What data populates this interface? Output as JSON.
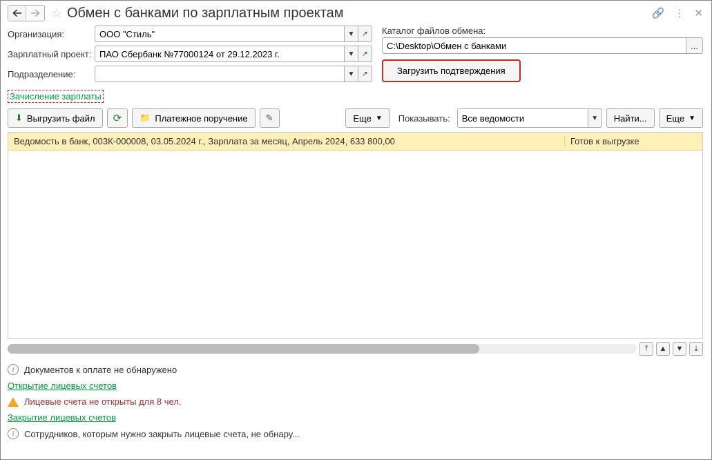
{
  "header": {
    "title": "Обмен с банками по зарплатным проектам"
  },
  "form": {
    "org_label": "Организация:",
    "org_value": "ООО \"Стиль\"",
    "project_label": "Зарплатный проект:",
    "project_value": "ПАО Сбербанк №77000124 от 29.12.2023 г.",
    "dept_label": "Подразделение:",
    "dept_value": ""
  },
  "catalog": {
    "label": "Каталог файлов обмена:",
    "value": "C:\\Desktop\\Обмен с банками",
    "browse": "...",
    "load_btn": "Загрузить подтверждения"
  },
  "tab": {
    "label": "Зачисление зарплаты"
  },
  "toolbar": {
    "export_label": "Выгрузить файл",
    "payorder_label": "Платежное поручение",
    "more1": "Еще",
    "show_label": "Показывать:",
    "filter_value": "Все ведомости",
    "find_label": "Найти...",
    "more2": "Еще"
  },
  "grid": {
    "rows": [
      {
        "main": "Ведомость в банк, 003К-000008, 03.05.2024 г., Зарплата за месяц, Апрель 2024, 633 800,00",
        "status": "Готов к выгрузке"
      }
    ]
  },
  "footer": {
    "no_docs": "Документов к оплате не обнаружено",
    "open_accounts": "Открытие лицевых счетов",
    "warn": "Лицевые счета не открыты для 8 чел.",
    "close_accounts": "Закрытие лицевых счетов",
    "close_info": "Сотрудников, которым нужно закрыть лицевые счета, не обнару..."
  }
}
